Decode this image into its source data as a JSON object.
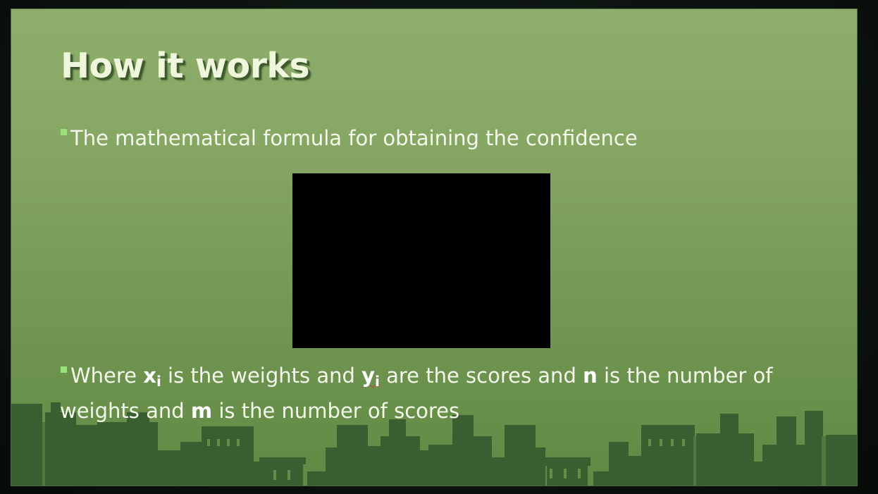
{
  "slide": {
    "title": "How it works",
    "bullet_1": "The mathematical formula for obtaining the confidence",
    "bullet_2": {
      "t1": "Where ",
      "var_x": "x",
      "sub_x": "i",
      "t2": " is the weights and ",
      "var_y": "y",
      "sub_y": "i",
      "t3": " are the scores and ",
      "var_n": "n",
      "t4": " is the number of",
      "t5": "weights and ",
      "var_m": "m",
      "t6": " is the number of scores"
    }
  },
  "colors": {
    "background_top": "#8fae6c",
    "background_bottom": "#5f8a43",
    "skyline": "#395e2f",
    "bullet_marker": "#9ce07a",
    "title_text": "#eef6dc"
  }
}
